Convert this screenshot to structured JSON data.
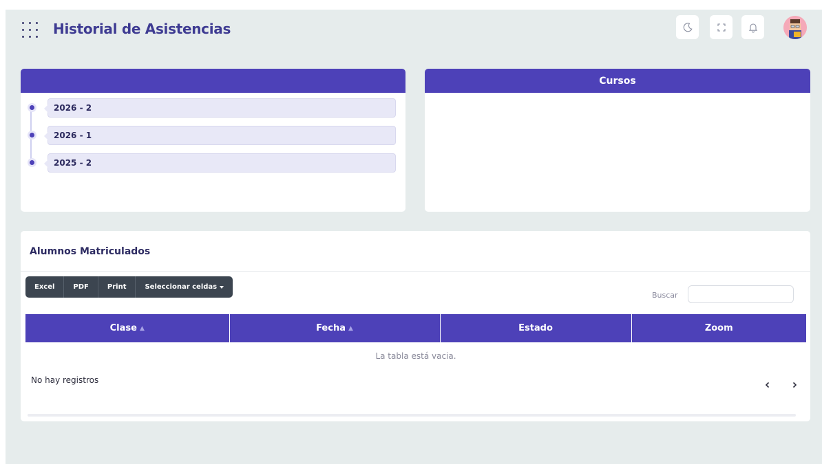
{
  "header": {
    "title": "Historial de Asistencias",
    "icons": [
      "apps-grid-icon",
      "moon-icon",
      "fullscreen-icon",
      "bell-icon",
      "user-avatar"
    ]
  },
  "periods_card": {
    "title": "",
    "items": [
      {
        "label": "2026 - 2"
      },
      {
        "label": "2026 - 1"
      },
      {
        "label": "2025 - 2"
      }
    ]
  },
  "cursos_card": {
    "title": "Cursos"
  },
  "alumnos": {
    "title": "Alumnos Matriculados",
    "buttons": {
      "excel": "Excel",
      "pdf": "PDF",
      "print": "Print",
      "select_cells": "Seleccionar celdas"
    },
    "search": {
      "label": "Buscar",
      "value": "",
      "placeholder": ""
    },
    "table": {
      "columns": [
        "Clase",
        "Fecha",
        "Estado",
        "Zoom"
      ],
      "empty_message": "La tabla está vacia."
    },
    "footer": {
      "records": "No hay registros"
    }
  },
  "colors": {
    "primary": "#4d41b8",
    "title": "#3e3b92",
    "background": "#e6ecec",
    "button_group": "#3c4550"
  }
}
